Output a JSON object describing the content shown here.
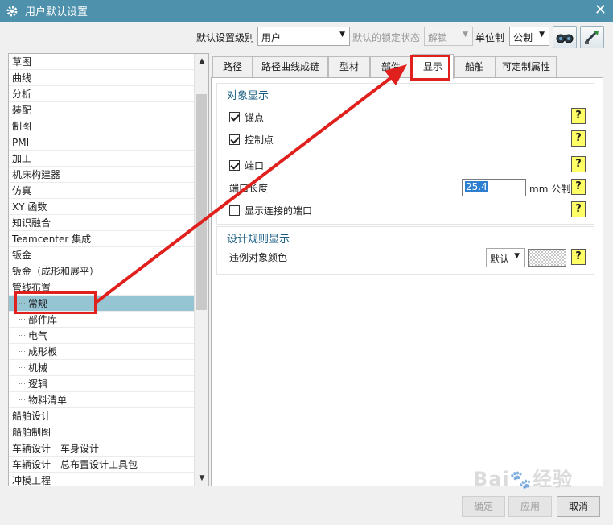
{
  "window": {
    "title": "用户默认设置",
    "close_glyph": "✕"
  },
  "toolbar": {
    "level_label": "默认设置级别",
    "level_value": "用户",
    "lock_label": "默认的锁定状态",
    "lock_value": "解锁",
    "unit_label": "单位制",
    "unit_value": "公制"
  },
  "tree": {
    "items": [
      {
        "label": "草图"
      },
      {
        "label": "曲线"
      },
      {
        "label": "分析"
      },
      {
        "label": "装配"
      },
      {
        "label": "制图"
      },
      {
        "label": "PMI"
      },
      {
        "label": "加工"
      },
      {
        "label": "机床构建器"
      },
      {
        "label": "仿真"
      },
      {
        "label": "XY 函数"
      },
      {
        "label": "知识融合"
      },
      {
        "label": "Teamcenter 集成"
      },
      {
        "label": "钣金"
      },
      {
        "label": "钣金（成形和展平）"
      },
      {
        "label": "管线布置"
      }
    ],
    "children": [
      {
        "label": "常规",
        "selected": true
      },
      {
        "label": "部件库"
      },
      {
        "label": "电气"
      },
      {
        "label": "成形板"
      },
      {
        "label": "机械"
      },
      {
        "label": "逻辑"
      },
      {
        "label": "物料清单"
      }
    ],
    "after": [
      {
        "label": "船舶设计"
      },
      {
        "label": "船舶制图"
      },
      {
        "label": "车辆设计 - 车身设计"
      },
      {
        "label": "车辆设计 - 总布置设计工具包"
      },
      {
        "label": "冲模工程"
      }
    ]
  },
  "tabs": [
    "路径",
    "路径曲线成链",
    "型材",
    "部件",
    "显示",
    "船舶",
    "可定制属性"
  ],
  "active_tab": "显示",
  "object_display": {
    "title": "对象显示",
    "anchor_label": "锚点",
    "control_point_label": "控制点",
    "port_label": "端口",
    "port_length_label": "端口长度",
    "port_length_value": "25.4",
    "port_length_unit": "mm 公制",
    "show_connected_ports_label": "显示连接的端口"
  },
  "design_rule_display": {
    "title": "设计规则显示",
    "violation_color_label": "违例对象颜色",
    "violation_color_value": "默认"
  },
  "buttons": {
    "ok": "确定",
    "apply": "应用",
    "cancel": "取消"
  },
  "colors": {
    "titlebar": "#4d91ad",
    "selected_row": "#95c4d3",
    "annotation": "#e0201d",
    "group_title": "#1a5e82"
  }
}
